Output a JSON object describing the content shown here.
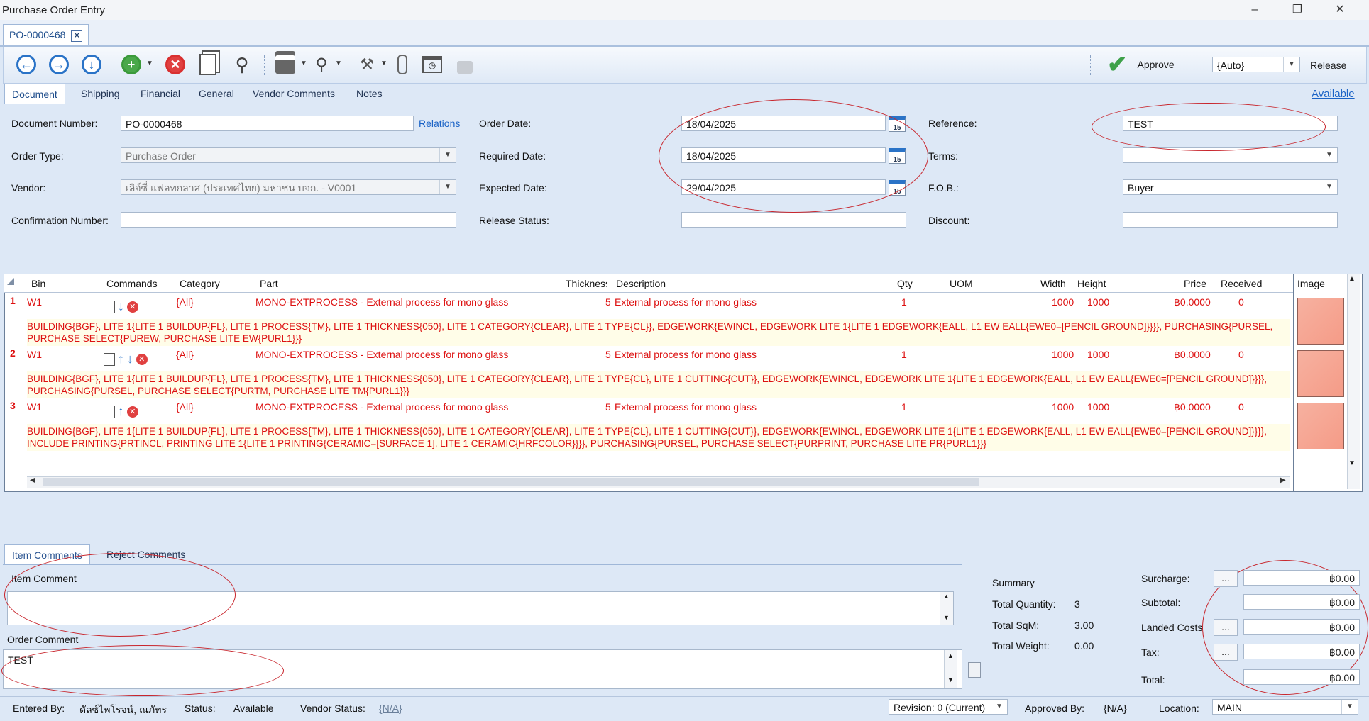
{
  "window": {
    "title": "Purchase Order Entry"
  },
  "doc_tab": {
    "label": "PO-0000468",
    "close": "✕"
  },
  "toolbar": {
    "approve_label": "Approve",
    "auto_value": "{Auto}",
    "release_label": "Release"
  },
  "tabs": [
    "Document",
    "Shipping",
    "Financial",
    "General",
    "Vendor Comments",
    "Notes"
  ],
  "available_link": "Available",
  "form": {
    "document_number_label": "Document Number:",
    "document_number": "PO-0000468",
    "relations_link": "Relations",
    "order_type_label": "Order Type:",
    "order_type": "Purchase Order",
    "vendor_label": "Vendor:",
    "vendor": "เลิจ์ซี่ แฟลทกลาส (ประเทศไทย) มหาชน บจก. - V0001",
    "confirmation_label": "Confirmation Number:",
    "confirmation": "",
    "order_date_label": "Order Date:",
    "order_date": "18/04/2025",
    "required_date_label": "Required Date:",
    "required_date": "18/04/2025",
    "expected_date_label": "Expected Date:",
    "expected_date": "29/04/2025",
    "release_status_label": "Release Status:",
    "release_status": "",
    "calendar_day": "15",
    "reference_label": "Reference:",
    "reference": "TEST",
    "terms_label": "Terms:",
    "terms": "",
    "fob_label": "F.O.B.:",
    "fob": "Buyer",
    "discount_label": "Discount:",
    "discount": ""
  },
  "grid": {
    "columns": [
      "Bin",
      "Commands",
      "Category",
      "Part",
      "Thickness",
      "Description",
      "Qty",
      "UOM",
      "Width",
      "Height",
      "Price",
      "Received"
    ],
    "image_column": "Image",
    "rows": [
      {
        "num": "1",
        "bin": "W1",
        "category": "{All}",
        "part": "MONO-EXTPROCESS - External process for mono glass",
        "thickness": "5",
        "description": "External process for mono glass",
        "qty": "1",
        "uom": "",
        "width": "1000",
        "height": "1000",
        "price": "฿0.0000",
        "received": "0",
        "detail_1": "BUILDING{BGF}, LITE 1{LITE 1 BUILDUP{FL}, LITE 1 PROCESS{TM}, LITE 1 THICKNESS{050}, LITE 1 CATEGORY{CLEAR}, LITE 1 TYPE{CL}}, EDGEWORK{EWINCL, EDGEWORK LITE 1{LITE 1 EDGEWORK{EALL, L1 EW EALL{EWE0=[PENCIL GROUND]}}}}, PURCHASING{PURSEL,",
        "detail_2": "PURCHASE SELECT{PUREW, PURCHASE LITE EW{PURL1}}}"
      },
      {
        "num": "2",
        "bin": "W1",
        "category": "{All}",
        "part": "MONO-EXTPROCESS - External process for mono glass",
        "thickness": "5",
        "description": "External process for mono glass",
        "qty": "1",
        "uom": "",
        "width": "1000",
        "height": "1000",
        "price": "฿0.0000",
        "received": "0",
        "detail_1": "BUILDING{BGF}, LITE 1{LITE 1 BUILDUP{FL}, LITE 1 PROCESS{TM}, LITE 1 THICKNESS{050}, LITE 1 CATEGORY{CLEAR}, LITE 1 TYPE{CL}, LITE 1 CUTTING{CUT}}, EDGEWORK{EWINCL, EDGEWORK LITE 1{LITE 1 EDGEWORK{EALL, L1 EW EALL{EWE0=[PENCIL GROUND]}}}},",
        "detail_2": "PURCHASING{PURSEL, PURCHASE SELECT{PURTM, PURCHASE LITE TM{PURL1}}}"
      },
      {
        "num": "3",
        "bin": "W1",
        "category": "{All}",
        "part": "MONO-EXTPROCESS - External process for mono glass",
        "thickness": "5",
        "description": "External process for mono glass",
        "qty": "1",
        "uom": "",
        "width": "1000",
        "height": "1000",
        "price": "฿0.0000",
        "received": "0",
        "detail_1": "BUILDING{BGF}, LITE 1{LITE 1 BUILDUP{FL}, LITE 1 PROCESS{TM}, LITE 1 THICKNESS{050}, LITE 1 CATEGORY{CLEAR}, LITE 1 TYPE{CL}, LITE 1 CUTTING{CUT}}, EDGEWORK{EWINCL, EDGEWORK LITE 1{LITE 1 EDGEWORK{EALL, L1 EW EALL{EWE0=[PENCIL GROUND]}}}},",
        "detail_2": "INCLUDE PRINTING{PRTINCL, PRINTING LITE 1{LITE 1 PRINTING{CERAMIC=[SURFACE 1], LITE 1 CERAMIC{HRFCOLOR}}}}, PURCHASING{PURSEL, PURCHASE SELECT{PURPRINT, PURCHASE LITE PR{PURL1}}}"
      }
    ]
  },
  "bottom_tabs": [
    "Item Comments",
    "Reject Comments"
  ],
  "comments": {
    "item_comment_label": "Item Comment",
    "item_comment": "",
    "order_comment_label": "Order Comment",
    "order_comment": "TEST"
  },
  "summary": {
    "title": "Summary",
    "total_quantity_label": "Total Quantity:",
    "total_quantity": "3",
    "total_sqm_label": "Total SqM:",
    "total_sqm": "3.00",
    "total_weight_label": "Total Weight:",
    "total_weight": "0.00"
  },
  "totals": {
    "surcharge_label": "Surcharge:",
    "surcharge": "฿0.00",
    "subtotal_label": "Subtotal:",
    "subtotal": "฿0.00",
    "landed_label": "Landed Costs",
    "landed": "฿0.00",
    "tax_label": "Tax:",
    "tax": "฿0.00",
    "total_label": "Total:",
    "total": "฿0.00",
    "ellipsis": "..."
  },
  "statusbar": {
    "entered_by_label": "Entered By:",
    "entered_by": "ดัลซ์ไพโรจน์, ณภัทร",
    "status_label": "Status:",
    "status": "Available",
    "vendor_status_label": "Vendor Status:",
    "vendor_status": "{N/A}",
    "revision": "Revision: 0 (Current)",
    "approved_by_label": "Approved By:",
    "approved_by": "{N/A}",
    "location_label": "Location:",
    "location": "MAIN"
  }
}
